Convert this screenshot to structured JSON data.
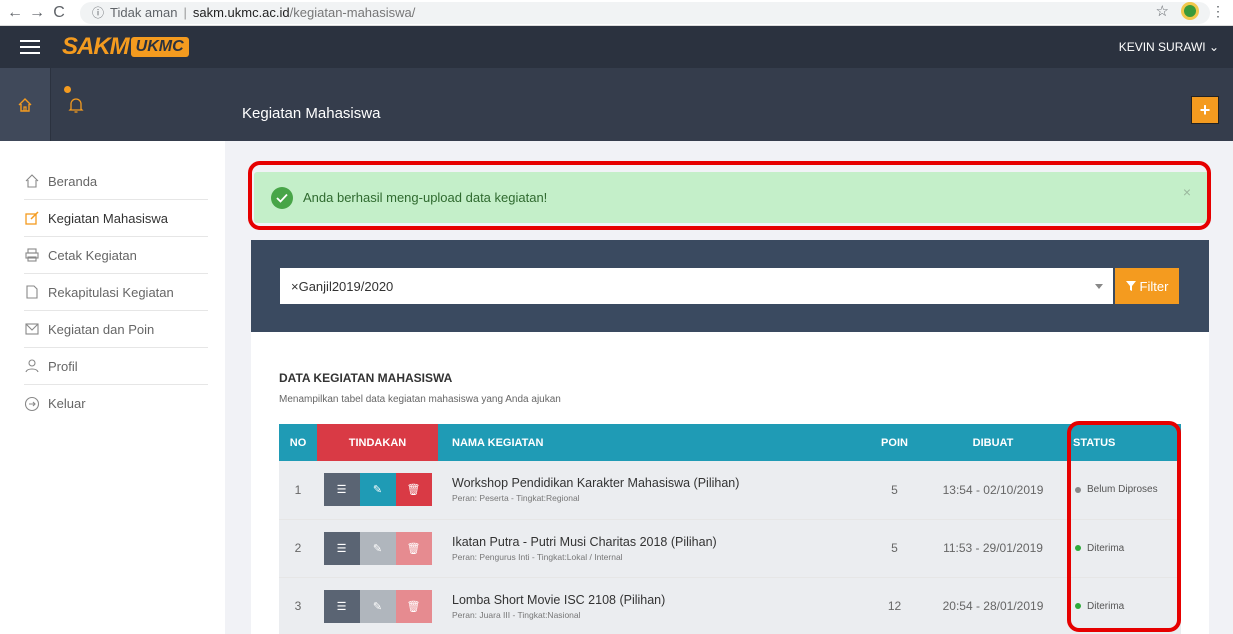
{
  "browser": {
    "back": "←",
    "forward": "→",
    "reload": "C",
    "info_icon": "ⓘ",
    "insecure": "Tidak aman",
    "separator": "|",
    "host": "sakm.ukmc.ac.id",
    "path": "/kegiatan-mahasiswa/",
    "star": "☆",
    "menu": "⋮"
  },
  "header": {
    "logo_a": "SAKM",
    "logo_b": "UKMC",
    "user": "KEVIN SURAWI ⌄"
  },
  "subheader": {
    "title": "Kegiatan Mahasiswa",
    "add_label": "+"
  },
  "sidebar": {
    "items": [
      {
        "label": "Beranda"
      },
      {
        "label": "Kegiatan Mahasiswa"
      },
      {
        "label": "Cetak Kegiatan"
      },
      {
        "label": "Rekapitulasi Kegiatan"
      },
      {
        "label": "Kegiatan dan Poin"
      },
      {
        "label": "Profil"
      },
      {
        "label": "Keluar"
      }
    ]
  },
  "alert": {
    "message": "Anda berhasil meng-upload data kegiatan!",
    "close": "×"
  },
  "filter": {
    "selected": "×Ganjil2019/2020",
    "button_label": "Filter"
  },
  "data_section": {
    "title": "DATA KEGIATAN MAHASISWA",
    "subtitle": "Menampilkan tabel data kegiatan mahasiswa yang Anda ajukan"
  },
  "table": {
    "headers": {
      "no": "NO",
      "tindakan": "TINDAKAN",
      "nama": "NAMA KEGIATAN",
      "poin": "POIN",
      "dibuat": "DIBUAT",
      "status": "STATUS"
    },
    "rows": [
      {
        "no": "1",
        "name": "Workshop Pendidikan Karakter Mahasiswa (Pilihan)",
        "role": "Peran: Peserta - Tingkat:Regional",
        "poin": "5",
        "dibuat": "13:54 - 02/10/2019",
        "status": "Belum Diproses"
      },
      {
        "no": "2",
        "name": "Ikatan Putra - Putri Musi Charitas 2018 (Pilihan)",
        "role": "Peran: Pengurus Inti - Tingkat:Lokal / Internal",
        "poin": "5",
        "dibuat": "11:53 - 29/01/2019",
        "status": "Diterima"
      },
      {
        "no": "3",
        "name": "Lomba Short Movie ISC 2108 (Pilihan)",
        "role": "Peran: Juara III - Tingkat:Nasional",
        "poin": "12",
        "dibuat": "20:54 - 28/01/2019",
        "status": "Diterima"
      }
    ]
  },
  "colors": {
    "accent": "#f49b1f",
    "header_bg": "#2b323f",
    "table_header": "#1f9bb5",
    "action_header": "#d93a45",
    "alert_bg": "#c4efc9",
    "status_pending": "#888888",
    "status_accepted": "#2eaa3a",
    "annotation": "#e60000"
  }
}
